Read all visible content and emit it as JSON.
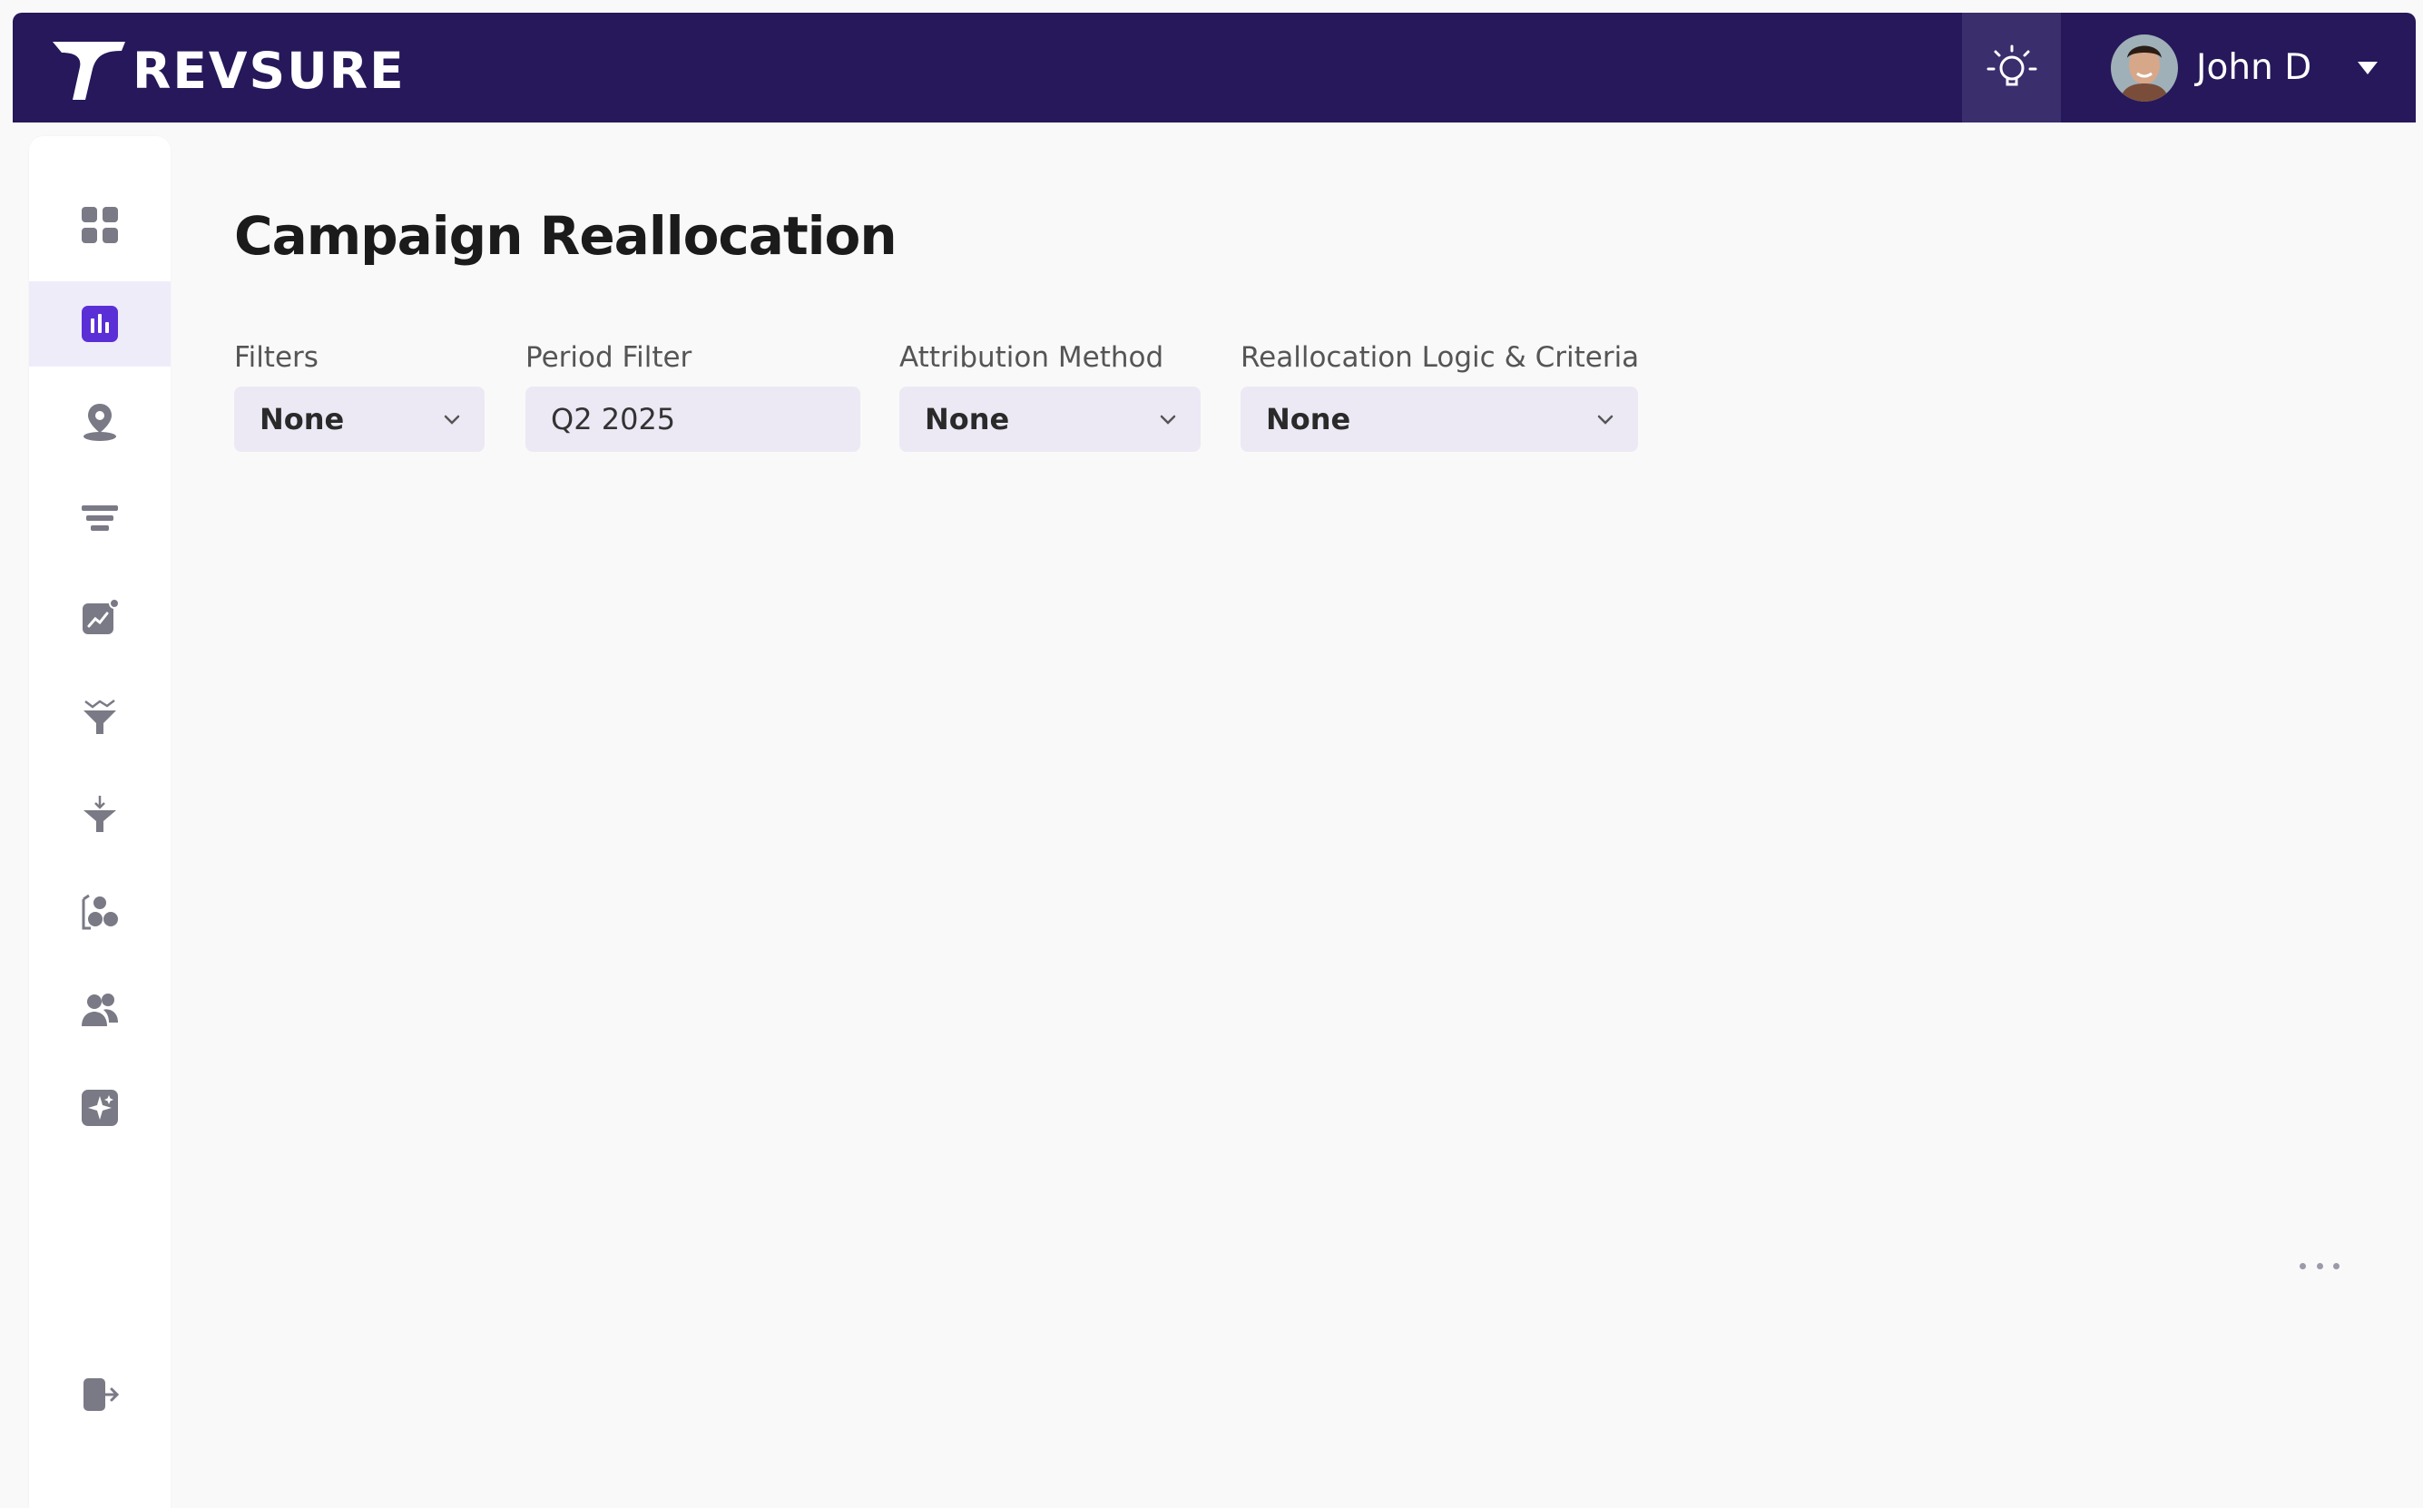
{
  "app": {
    "brand_name": "REVSURE",
    "brand_color": "#26185a",
    "accent_color": "#5b2fd6"
  },
  "header": {
    "insights_icon": "lightbulb-icon",
    "user": {
      "name": "John D",
      "menu_icon": "caret-down-icon"
    }
  },
  "sidebar": {
    "items": [
      {
        "id": "dashboard",
        "icon": "grid-icon",
        "active": false
      },
      {
        "id": "analytics",
        "icon": "bar-chart-icon",
        "active": true
      },
      {
        "id": "location",
        "icon": "map-pin-icon",
        "active": false
      },
      {
        "id": "funnel",
        "icon": "funnel-layers-icon",
        "active": false
      },
      {
        "id": "trends",
        "icon": "trend-chart-icon",
        "active": false
      },
      {
        "id": "funnel-trend",
        "icon": "funnel-trend-icon",
        "active": false
      },
      {
        "id": "funnel-down",
        "icon": "funnel-down-icon",
        "active": false
      },
      {
        "id": "segments",
        "icon": "segments-icon",
        "active": false
      },
      {
        "id": "users",
        "icon": "users-icon",
        "active": false
      },
      {
        "id": "ai",
        "icon": "sparkle-icon",
        "active": false
      }
    ],
    "logout_icon": "logout-icon"
  },
  "main": {
    "title": "Campaign Reallocation",
    "filters": [
      {
        "label": "Filters",
        "value": "None",
        "type": "select"
      },
      {
        "label": "Period Filter",
        "value": "Q2 2025",
        "type": "input"
      },
      {
        "label": "Attribution Method",
        "value": "None",
        "type": "select"
      },
      {
        "label": "Reallocation Logic & Criteria",
        "value": "None",
        "type": "select"
      }
    ],
    "more_icon": "more-dots-icon"
  }
}
